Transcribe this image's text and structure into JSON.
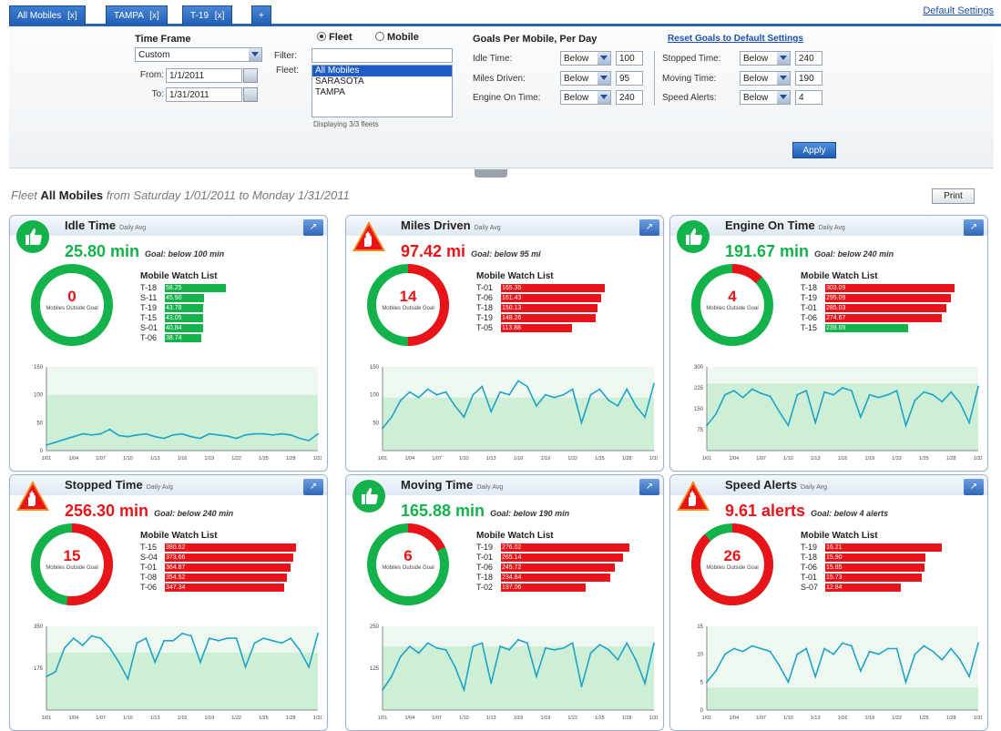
{
  "tabs": [
    {
      "label": "All Mobiles",
      "close": "[x]",
      "active": true
    },
    {
      "label": "TAMPA",
      "close": "[x]",
      "active": false
    },
    {
      "label": "T-19",
      "close": "[x]",
      "active": false
    },
    {
      "label": "+",
      "close": "",
      "active": false
    }
  ],
  "default_settings_link": "Default Settings",
  "filters": {
    "time_frame_label": "Time Frame",
    "time_frame_value": "Custom",
    "from_label": "From:",
    "from_value": "1/1/2011",
    "to_label": "To:",
    "to_value": "1/31/2011",
    "radio_fleet": "Fleet",
    "radio_mobile": "Mobile",
    "filter_label": "Filter:",
    "filter_value": "",
    "fleet_label": "Fleet:",
    "fleet_options": [
      "All Mobiles",
      "SARASOTA",
      "TAMPA"
    ],
    "fleet_selected": "All Mobiles",
    "displaying": "Displaying 3/3 fleets",
    "goals_title": "Goals Per Mobile, Per Day",
    "reset_goals": "Reset Goals to Default Settings",
    "goals_left": [
      {
        "label": "Idle Time:",
        "op": "Below",
        "value": "100"
      },
      {
        "label": "Miles Driven:",
        "op": "Below",
        "value": "95"
      },
      {
        "label": "Engine On Time:",
        "op": "Below",
        "value": "240"
      }
    ],
    "goals_right": [
      {
        "label": "Stopped Time:",
        "op": "Below",
        "value": "240"
      },
      {
        "label": "Moving Time:",
        "op": "Below",
        "value": "190"
      },
      {
        "label": "Speed Alerts:",
        "op": "Below",
        "value": "4"
      }
    ],
    "apply": "Apply"
  },
  "subtitle": {
    "prefix": "Fleet",
    "fleet": "All Mobiles",
    "range": "from Saturday 1/01/2011 to Monday 1/31/2011"
  },
  "print": "Print",
  "colors": {
    "green": "#14b24a",
    "red": "#e8141a",
    "band": "#ccefd6",
    "line": "#1ea3c9"
  },
  "common": {
    "daily_avg": "Daily Avg",
    "watch_list": "Mobile Watch List",
    "mobiles_outside": "Mobiles Outside Goal"
  },
  "cards": [
    {
      "title": "Idle Time",
      "status": "good",
      "value": "25.80 min",
      "goal": "Goal: below 100 min",
      "outside": "0",
      "red_fraction": 0.0,
      "watch": [
        {
          "id": "T-18",
          "val": "58.25",
          "pct": 0.42,
          "over": false
        },
        {
          "id": "S-11",
          "val": "45.90",
          "pct": 0.27,
          "over": false
        },
        {
          "id": "T-19",
          "val": "43.78",
          "pct": 0.26,
          "over": false
        },
        {
          "id": "T-15",
          "val": "43.05",
          "pct": 0.26,
          "over": false
        },
        {
          "id": "S-01",
          "val": "40.84",
          "pct": 0.26,
          "over": false
        },
        {
          "id": "T-06",
          "val": "38.74",
          "pct": 0.25,
          "over": false
        }
      ],
      "chart_data": {
        "type": "line",
        "y_ticks": [
          "150",
          "100",
          "50",
          "0"
        ],
        "ylim": [
          0,
          150
        ],
        "goal": 100,
        "x_ticks": [
          "1/01",
          "1/04",
          "1/07",
          "1/10",
          "1/13",
          "1/16",
          "1/19",
          "1/22",
          "1/25",
          "1/28",
          "1/31"
        ],
        "values": [
          10,
          15,
          20,
          25,
          30,
          28,
          30,
          38,
          27,
          25,
          28,
          30,
          25,
          22,
          28,
          30,
          25,
          22,
          30,
          28,
          26,
          22,
          28,
          30,
          30,
          28,
          30,
          28,
          22,
          18,
          30
        ]
      }
    },
    {
      "title": "Miles Driven",
      "status": "bad",
      "value": "97.42 mi",
      "goal": "Goal: below 95 mi",
      "outside": "14",
      "red_fraction": 0.5,
      "watch": [
        {
          "id": "T-01",
          "val": "165.35",
          "pct": 0.71,
          "over": true
        },
        {
          "id": "T-06",
          "val": "161.43",
          "pct": 0.69,
          "over": true
        },
        {
          "id": "T-18",
          "val": "150.13",
          "pct": 0.66,
          "over": true
        },
        {
          "id": "T-19",
          "val": "148.26",
          "pct": 0.65,
          "over": true
        },
        {
          "id": "T-05",
          "val": "113.88",
          "pct": 0.49,
          "over": true
        }
      ],
      "chart_data": {
        "type": "line",
        "y_ticks": [
          "150",
          "100",
          "50"
        ],
        "ylim": [
          0,
          150
        ],
        "goal": 95,
        "x_ticks": [
          "1/01",
          "1/04",
          "1/07",
          "1/10",
          "1/13",
          "1/16",
          "1/19",
          "1/22",
          "1/25",
          "1/28",
          "1/31"
        ],
        "values": [
          40,
          60,
          90,
          105,
          95,
          110,
          100,
          105,
          80,
          60,
          100,
          115,
          70,
          105,
          100,
          125,
          115,
          80,
          100,
          95,
          100,
          110,
          50,
          100,
          110,
          90,
          80,
          110,
          80,
          60,
          120
        ]
      }
    },
    {
      "title": "Engine On Time",
      "status": "good",
      "value": "191.67 min",
      "goal": "Goal: below 240 min",
      "outside": "4",
      "red_fraction": 0.13,
      "watch": [
        {
          "id": "T-18",
          "val": "303.09",
          "pct": 0.89,
          "over": true
        },
        {
          "id": "T-19",
          "val": "295.09",
          "pct": 0.86,
          "over": true
        },
        {
          "id": "T-01",
          "val": "285.03",
          "pct": 0.83,
          "over": true
        },
        {
          "id": "T-06",
          "val": "274.67",
          "pct": 0.8,
          "over": true
        },
        {
          "id": "T-15",
          "val": "239.69",
          "pct": 0.57,
          "over": false
        }
      ],
      "chart_data": {
        "type": "line",
        "y_ticks": [
          "300",
          "225",
          "150",
          "75"
        ],
        "ylim": [
          0,
          300
        ],
        "goal": 240,
        "x_ticks": [
          "1/01",
          "1/04",
          "1/07",
          "1/10",
          "1/13",
          "1/16",
          "1/19",
          "1/22",
          "1/25",
          "1/28",
          "1/31"
        ],
        "values": [
          90,
          130,
          200,
          215,
          190,
          220,
          205,
          195,
          140,
          90,
          200,
          215,
          100,
          210,
          200,
          225,
          215,
          120,
          200,
          190,
          200,
          215,
          90,
          180,
          210,
          200,
          175,
          210,
          170,
          100,
          230
        ]
      }
    },
    {
      "title": "Stopped Time",
      "status": "bad",
      "value": "256.30 min",
      "goal": "Goal: below 240 min",
      "outside": "15",
      "red_fraction": 0.52,
      "watch": [
        {
          "id": "T-15",
          "val": "380.62",
          "pct": 0.9,
          "over": true
        },
        {
          "id": "S-04",
          "val": "373.66",
          "pct": 0.88,
          "over": true
        },
        {
          "id": "T-01",
          "val": "364.87",
          "pct": 0.86,
          "over": true
        },
        {
          "id": "T-08",
          "val": "354.52",
          "pct": 0.84,
          "over": true
        },
        {
          "id": "T-06",
          "val": "347.34",
          "pct": 0.82,
          "over": true
        }
      ],
      "chart_data": {
        "type": "line",
        "y_ticks": [
          "350",
          "175"
        ],
        "ylim": [
          0,
          350
        ],
        "goal": 240,
        "x_ticks": [
          "1/01",
          "1/04",
          "1/07",
          "1/10",
          "1/13",
          "1/16",
          "1/19",
          "1/22",
          "1/25",
          "1/28",
          "1/31"
        ],
        "values": [
          140,
          160,
          260,
          300,
          270,
          310,
          300,
          260,
          200,
          130,
          280,
          300,
          200,
          290,
          290,
          320,
          310,
          200,
          300,
          290,
          300,
          300,
          180,
          280,
          300,
          290,
          280,
          300,
          250,
          180,
          320
        ]
      }
    },
    {
      "title": "Moving Time",
      "status": "good",
      "value": "165.88 min",
      "goal": "Goal: below 190 min",
      "outside": "6",
      "red_fraction": 0.18,
      "watch": [
        {
          "id": "T-19",
          "val": "276.02",
          "pct": 0.88,
          "over": true
        },
        {
          "id": "T-01",
          "val": "265.14",
          "pct": 0.84,
          "over": true
        },
        {
          "id": "T-06",
          "val": "245.72",
          "pct": 0.78,
          "over": true
        },
        {
          "id": "T-18",
          "val": "234.84",
          "pct": 0.75,
          "over": true
        },
        {
          "id": "T-02",
          "val": "197.06",
          "pct": 0.58,
          "over": true
        }
      ],
      "chart_data": {
        "type": "line",
        "y_ticks": [
          "250",
          "125"
        ],
        "ylim": [
          0,
          250
        ],
        "goal": 190,
        "x_ticks": [
          "1/01",
          "1/04",
          "1/07",
          "1/10",
          "1/13",
          "1/16",
          "1/19",
          "1/22",
          "1/25",
          "1/28",
          "1/31"
        ],
        "values": [
          60,
          100,
          160,
          190,
          170,
          200,
          185,
          180,
          130,
          60,
          190,
          200,
          80,
          190,
          180,
          210,
          200,
          100,
          185,
          180,
          185,
          200,
          70,
          170,
          195,
          180,
          150,
          200,
          150,
          80,
          200
        ]
      }
    },
    {
      "title": "Speed Alerts",
      "status": "bad",
      "value": "9.61 alerts",
      "goal": "Goal: below 4 alerts",
      "outside": "26",
      "red_fraction": 0.88,
      "watch": [
        {
          "id": "T-19",
          "val": "16.21",
          "pct": 0.8,
          "over": true
        },
        {
          "id": "T-18",
          "val": "15.90",
          "pct": 0.69,
          "over": true
        },
        {
          "id": "T-06",
          "val": "15.85",
          "pct": 0.68,
          "over": true
        },
        {
          "id": "T-01",
          "val": "15.73",
          "pct": 0.66,
          "over": true
        },
        {
          "id": "S-07",
          "val": "12.84",
          "pct": 0.52,
          "over": true
        }
      ],
      "chart_data": {
        "type": "line",
        "y_ticks": [
          "15",
          "10",
          "5",
          "0"
        ],
        "ylim": [
          0,
          15
        ],
        "goal": 4,
        "x_ticks": [
          "1/01",
          "1/04",
          "1/07",
          "1/10",
          "1/13",
          "1/16",
          "1/19",
          "1/22",
          "1/25",
          "1/28",
          "1/31"
        ],
        "values": [
          5,
          7,
          10,
          11,
          10.5,
          11.5,
          11,
          10.5,
          8,
          5,
          10,
          11,
          6,
          11,
          10,
          12,
          11.5,
          7,
          10.5,
          10,
          11,
          11,
          5,
          10,
          11.5,
          10.5,
          9,
          11,
          9,
          6,
          12
        ]
      }
    }
  ]
}
